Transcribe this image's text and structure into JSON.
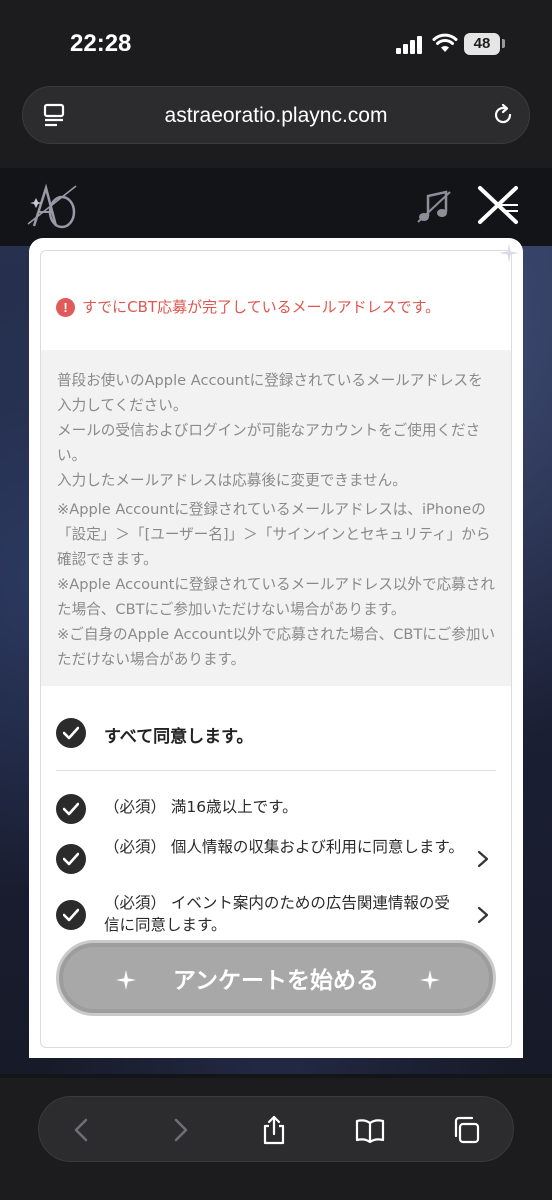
{
  "status_bar": {
    "time": "22:28",
    "battery": "48"
  },
  "browser": {
    "url": "astraeoratio.plaync.com"
  },
  "modal": {
    "error_message": "すでにCBT応募が完了しているメールアドレスです。",
    "info_lines": [
      "普段お使いのApple Accountに登録されているメールアドレスを入力してください。",
      "メールの受信およびログインが可能なアカウントをご使用ください。",
      "入力したメールアドレスは応募後に変更できません。",
      "※Apple Accountに登録されているメールアドレスは、iPhoneの「設定」＞「[ユーザー名]」＞「サインインとセキュリティ」から確認できます。",
      "※Apple Accountに登録されているメールアドレス以外で応募された場合、CBTにご参加いただけない場合があります。",
      "※ご自身のApple Account以外で応募された場合、CBTにご参加いただけない場合があります。"
    ],
    "agree_all_label": "すべて同意します。",
    "terms": [
      {
        "label": "（必須） 満16歳以上です。",
        "checked": true,
        "has_detail": false
      },
      {
        "label": "（必須） 個人情報の収集および利用に同意します。",
        "checked": true,
        "has_detail": true
      },
      {
        "label": "（必須） イベント案内のための広告関連情報の受信に同意します。",
        "checked": true,
        "has_detail": true
      }
    ],
    "start_button_label": "アンケートを始める"
  },
  "colors": {
    "error": "#e0564f",
    "button_disabled": "#a8a8a8",
    "check_bg": "#2b2b2b"
  },
  "icons": [
    "reader-icon",
    "reload-icon",
    "logo-icon",
    "music-off-icon",
    "close-icon",
    "sparkle-icon",
    "check-icon",
    "chevron-right-icon",
    "back-icon",
    "forward-icon",
    "share-icon",
    "bookmarks-icon",
    "tabs-icon"
  ]
}
